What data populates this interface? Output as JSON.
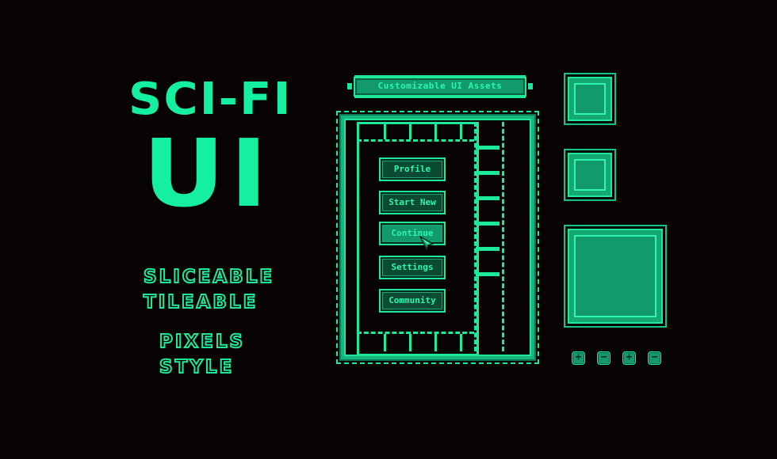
{
  "hero": {
    "title_line1": "SCI-FI",
    "title_line2": "UI",
    "features": [
      "SLICEABLE",
      "TILEABLE",
      "PIXELS",
      "STYLE"
    ]
  },
  "banner": {
    "text": "Customizable UI Assets"
  },
  "menu": {
    "buttons": [
      {
        "label": "Profile",
        "state": "normal"
      },
      {
        "label": "Start New",
        "state": "normal"
      },
      {
        "label": "Continue",
        "state": "hover"
      },
      {
        "label": "Settings",
        "state": "normal"
      },
      {
        "label": "Community",
        "state": "normal"
      }
    ],
    "cursor_icon": "arrow-cursor-icon"
  },
  "panels": [
    "small-panel",
    "small-panel",
    "large-panel"
  ],
  "controls": [
    {
      "icon": "plus-icon",
      "glyph": "+"
    },
    {
      "icon": "minus-icon",
      "glyph": "−"
    },
    {
      "icon": "plus-icon",
      "glyph": "+"
    },
    {
      "icon": "minus-icon",
      "glyph": "−"
    }
  ],
  "colors": {
    "background": "#080304",
    "accent": "#14f0a0",
    "panel_fill": "#129a6c",
    "button_fill": "#0b4a33"
  }
}
